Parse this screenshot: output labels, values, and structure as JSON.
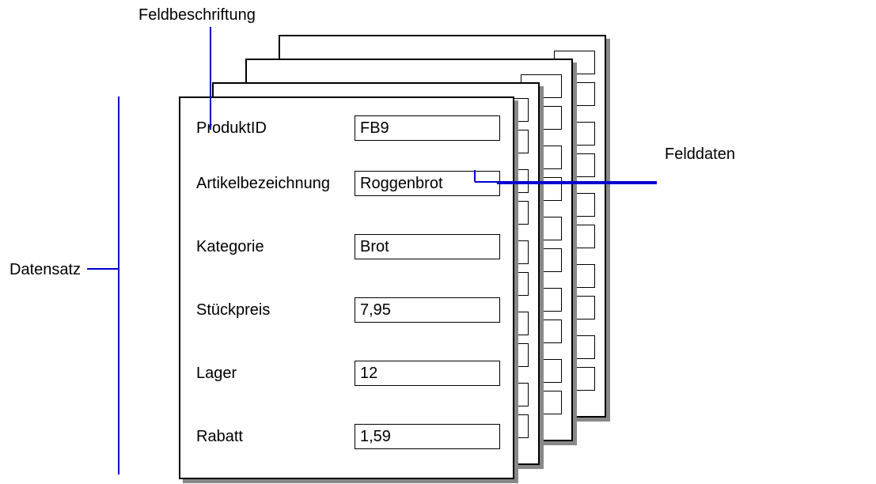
{
  "annotations": {
    "field_label": "Feldbeschriftung",
    "record": "Datensatz",
    "field_data": "Felddaten"
  },
  "record": {
    "fields": [
      {
        "label": "ProduktID",
        "value": "FB9"
      },
      {
        "label": "Artikelbezeichnung",
        "value": "Roggenbrot"
      },
      {
        "label": "Kategorie",
        "value": "Brot"
      },
      {
        "label": "Stückpreis",
        "value": "7,95"
      },
      {
        "label": "Lager",
        "value": "12"
      },
      {
        "label": "Rabatt",
        "value": "1,59"
      }
    ]
  }
}
